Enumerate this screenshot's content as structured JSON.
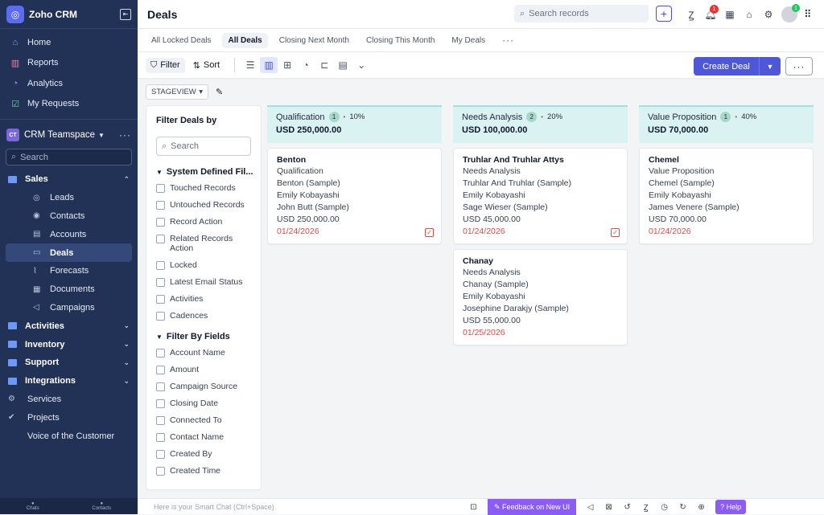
{
  "sidebar": {
    "app_name": "Zoho CRM",
    "top_items": [
      {
        "label": "Home",
        "icon": "home-icon"
      },
      {
        "label": "Reports",
        "icon": "reports-icon"
      },
      {
        "label": "Analytics",
        "icon": "analytics-icon"
      },
      {
        "label": "My Requests",
        "icon": "requests-icon"
      }
    ],
    "team": {
      "badge": "CT",
      "name": "CRM Teamspace"
    },
    "search_placeholder": "Search",
    "sales": {
      "label": "Sales",
      "items": [
        "Leads",
        "Contacts",
        "Accounts",
        "Deals",
        "Forecasts",
        "Documents",
        "Campaigns"
      ],
      "active": "Deals"
    },
    "folders": [
      "Activities",
      "Inventory",
      "Support",
      "Integrations"
    ],
    "extra": [
      "Services",
      "Projects",
      "Voice of the Customer"
    ],
    "bottom": [
      "Chats",
      "Contacts"
    ]
  },
  "header": {
    "title": "Deals",
    "search_placeholder": "Search records",
    "notification_count": "1",
    "avatar_badge": "1"
  },
  "tabs": [
    "All Locked Deals",
    "All Deals",
    "Closing Next Month",
    "Closing This Month",
    "My Deals"
  ],
  "active_tab": "All Deals",
  "toolbar": {
    "filter": "Filter",
    "sort": "Sort",
    "create": "Create Deal",
    "view": "STAGEVIEW"
  },
  "filter_panel": {
    "title": "Filter Deals by",
    "search_placeholder": "Search",
    "system_title": "System Defined Fil...",
    "system_items": [
      "Touched Records",
      "Untouched Records",
      "Record Action",
      "Related Records Action",
      "Locked",
      "Latest Email Status",
      "Activities",
      "Cadences"
    ],
    "fields_title": "Filter By Fields",
    "field_items": [
      "Account Name",
      "Amount",
      "Campaign Source",
      "Closing Date",
      "Connected To",
      "Contact Name",
      "Created By",
      "Created Time"
    ]
  },
  "columns": [
    {
      "name": "Qualification",
      "count": "1",
      "percent": "10%",
      "amount": "USD 250,000.00",
      "cards": [
        {
          "name": "Benton",
          "lines": [
            "Qualification",
            "Benton (Sample)",
            "Emily Kobayashi",
            "John Butt (Sample)",
            "USD 250,000.00"
          ],
          "date": "01/24/2026",
          "task": true
        }
      ]
    },
    {
      "name": "Needs Analysis",
      "count": "2",
      "percent": "20%",
      "amount": "USD 100,000.00",
      "cards": [
        {
          "name": "Truhlar And Truhlar Attys",
          "lines": [
            "Needs Analysis",
            "Truhlar And Truhlar (Sample)",
            "Emily Kobayashi",
            "Sage Wieser (Sample)",
            "USD 45,000.00"
          ],
          "date": "01/24/2026",
          "task": true
        },
        {
          "name": "Chanay",
          "lines": [
            "Needs Analysis",
            "Chanay (Sample)",
            "Emily Kobayashi",
            "Josephine Darakjy (Sample)",
            "USD 55,000.00"
          ],
          "date": "01/25/2026",
          "task": false
        }
      ]
    },
    {
      "name": "Value Proposition",
      "count": "1",
      "percent": "40%",
      "amount": "USD 70,000.00",
      "cards": [
        {
          "name": "Chemel",
          "lines": [
            "Value Proposition",
            "Chemel (Sample)",
            "Emily Kobayashi",
            "James Venere (Sample)",
            "USD 70,000.00"
          ],
          "date": "01/24/2026",
          "task": false
        }
      ]
    }
  ],
  "bottombar": {
    "chat_placeholder": "Here is your Smart Chat (Ctrl+Space)",
    "feedback": "Feedback on New UI",
    "help": "Help"
  },
  "colors": {
    "sidebar": "#213256",
    "accent": "#4f57d9",
    "stage_header": "#dbf2f3",
    "overdue": "#e04848"
  }
}
